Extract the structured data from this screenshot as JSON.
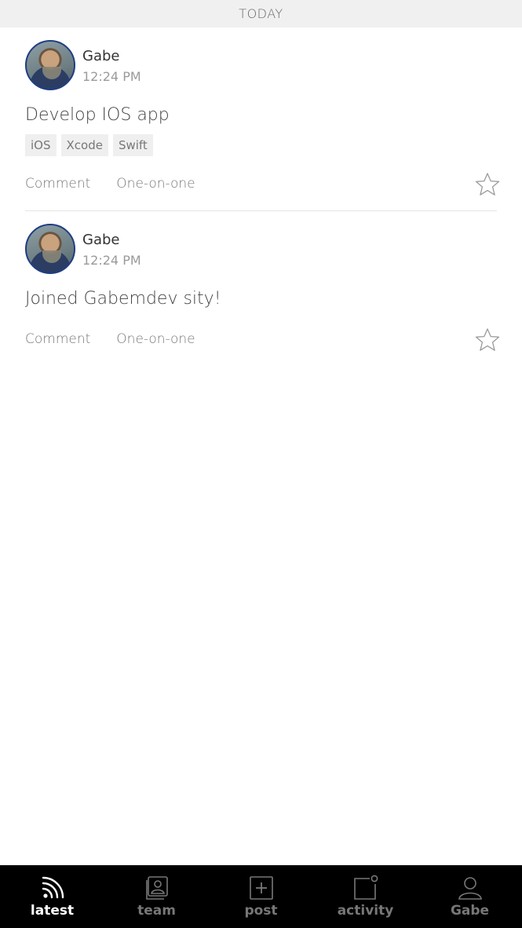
{
  "section": {
    "label": "TODAY"
  },
  "posts": [
    {
      "author": "Gabe",
      "time": "12:24 PM",
      "title": "Develop IOS app",
      "tags": [
        "iOS",
        "Xcode",
        "Swift"
      ],
      "actions": {
        "comment": "Comment",
        "one_on_one": "One-on-one"
      },
      "starred": false
    },
    {
      "author": "Gabe",
      "time": "12:24 PM",
      "title": "Joined Gabemdev sity!",
      "tags": [],
      "actions": {
        "comment": "Comment",
        "one_on_one": "One-on-one"
      },
      "starred": false
    }
  ],
  "tabbar": {
    "active": "latest",
    "items": [
      {
        "label": "latest",
        "icon": "rss-icon"
      },
      {
        "label": "team",
        "icon": "team-icon"
      },
      {
        "label": "post",
        "icon": "add-post-icon"
      },
      {
        "label": "activity",
        "icon": "activity-icon"
      },
      {
        "label": "Gabe",
        "icon": "profile-icon"
      }
    ]
  },
  "colors": {
    "header_bg": "#f0f0f0",
    "tabbar_bg": "#000000",
    "tab_active": "#ffffff",
    "tab_inactive": "#777777",
    "tag_bg": "#efefef"
  }
}
